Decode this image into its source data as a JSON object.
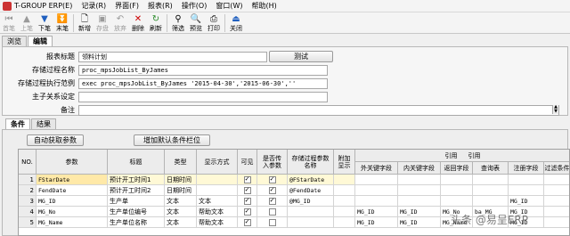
{
  "menu": {
    "items": [
      "T-GROUP ERP(E)",
      "记录(R)",
      "界面(F)",
      "报表(R)",
      "操作(O)",
      "窗口(W)",
      "帮助(H)"
    ]
  },
  "toolbar": {
    "buttons": [
      {
        "label": "首笔",
        "icon": "first-icon",
        "enabled": false
      },
      {
        "label": "上笔",
        "icon": "prev-icon",
        "enabled": false
      },
      {
        "label": "下笔",
        "icon": "next-icon",
        "enabled": true
      },
      {
        "label": "末笔",
        "icon": "last-icon",
        "enabled": true
      },
      {
        "label": "新增",
        "icon": "new-icon",
        "enabled": true
      },
      {
        "label": "存盘",
        "icon": "save-icon",
        "enabled": false
      },
      {
        "label": "放弃",
        "icon": "discard-icon",
        "enabled": false
      },
      {
        "label": "删除",
        "icon": "delete-icon",
        "enabled": true
      },
      {
        "label": "刷新",
        "icon": "refresh-icon",
        "enabled": true
      },
      {
        "label": "筛选",
        "icon": "filter-icon",
        "enabled": true
      },
      {
        "label": "预览",
        "icon": "preview-icon",
        "enabled": true
      },
      {
        "label": "打印",
        "icon": "print-icon",
        "enabled": true
      },
      {
        "label": "关闭",
        "icon": "close-icon",
        "enabled": true
      }
    ]
  },
  "tabs": {
    "browse": "浏览",
    "edit": "编辑"
  },
  "form": {
    "report_title_label": "报表标题",
    "report_title_value": "领料计划",
    "test_button": "测试",
    "proc_name_label": "存储过程名称",
    "proc_name_value": "proc_mpsJobList_ByJames",
    "proc_example_label": "存储过程执行范例",
    "proc_example_value": "exec proc_mpsJobList_ByJames '2015-04-30','2015-06-30',''",
    "master_detail_label": "主子关系设定",
    "master_detail_value": "",
    "remark_label": "备注",
    "remark_value": ""
  },
  "subtabs": {
    "conditions": "条件",
    "results": "结果"
  },
  "buttons": {
    "auto_get_params": "自动获取参数",
    "add_default_field": "增加默认条件栏位"
  },
  "grid": {
    "headers": {
      "no": "NO.",
      "param": "参数",
      "title": "标题",
      "type": "类型",
      "display": "显示方式",
      "visible": "可见",
      "pass": "是否传入参数",
      "proc_param": "存储过程参数名称",
      "extra": "附加显示",
      "group_ref": "引用",
      "group_ref2": "引用",
      "ext_key": "外关键字段",
      "int_key": "内关键字段",
      "ret_field": "返回字段",
      "query_table": "查询表",
      "reg_field": "注册字段",
      "filter_cond": "过滤条件"
    },
    "rows": [
      {
        "no": "1",
        "param": "FStarDate",
        "title": "预计开工时间1",
        "type": "日期时间",
        "display": "",
        "visible": true,
        "pass": true,
        "proc_param": "@FStarDate",
        "ext_key": "",
        "int_key": "",
        "ret_field": "",
        "query_table": "",
        "reg_field": "",
        "filter": ""
      },
      {
        "no": "2",
        "param": "FendDate",
        "title": "预计开工时间2",
        "type": "日期时间",
        "display": "",
        "visible": true,
        "pass": true,
        "proc_param": "@FendDate",
        "ext_key": "",
        "int_key": "",
        "ret_field": "",
        "query_table": "",
        "reg_field": "",
        "filter": ""
      },
      {
        "no": "3",
        "param": "MG_ID",
        "title": "生产单",
        "type": "文本",
        "display": "文本",
        "visible": true,
        "pass": true,
        "proc_param": "@MG_ID",
        "ext_key": "",
        "int_key": "",
        "ret_field": "",
        "query_table": "",
        "reg_field": "MG_ID",
        "filter": ""
      },
      {
        "no": "4",
        "param": "MG_No",
        "title": "生产单位编号",
        "type": "文本",
        "display": "帮助文本",
        "visible": true,
        "pass": false,
        "proc_param": "",
        "ext_key": "MG_ID",
        "int_key": "MG_ID",
        "ret_field": "MG_No",
        "query_table": "ba_MG",
        "reg_field": "MG_ID",
        "filter": ""
      },
      {
        "no": "5",
        "param": "MG_Name",
        "title": "生产单位名称",
        "type": "文本",
        "display": "帮助文本",
        "visible": true,
        "pass": false,
        "proc_param": "",
        "ext_key": "MG_ID",
        "int_key": "MG_ID",
        "ret_field": "MG_Name",
        "query_table": "",
        "reg_field": "MG_ID",
        "filter": ""
      }
    ]
  },
  "watermark": "头条 @易呈ERP"
}
